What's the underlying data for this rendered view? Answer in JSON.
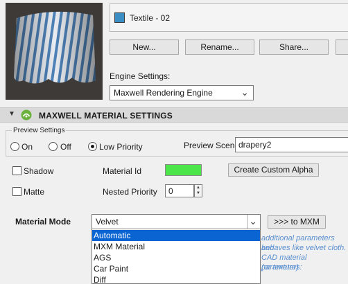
{
  "material": {
    "name": "Textile - 02",
    "swatch_color": "#3b8ec4"
  },
  "toolbar": {
    "new_label": "New...",
    "rename_label": "Rename...",
    "share_label": "Share..."
  },
  "engine": {
    "label": "Engine Settings:",
    "value": "Maxwell Rendering Engine"
  },
  "section": {
    "title": "MAXWELL MATERIAL SETTINGS",
    "logo_color": "#6ab23d"
  },
  "preview": {
    "group_label": "Preview Settings",
    "options": [
      "On",
      "Off",
      "Low Priority"
    ],
    "selected": "Low Priority",
    "scene_label": "Preview Scene",
    "scene_value": "drapery2"
  },
  "props": {
    "shadow_label": "Shadow",
    "matte_label": "Matte",
    "material_id_label": "Material Id",
    "material_id_color": "#4ce64a",
    "custom_alpha_label": "Create Custom Alpha",
    "nested_priority_label": "Nested Priority",
    "nested_priority_value": "0"
  },
  "mode": {
    "label": "Material Mode",
    "value": "Velvet",
    "to_mxm_label": ">>> to MXM",
    "options": [
      "Automatic",
      "MXM Material",
      "AGS",
      "Car Paint",
      "Diff"
    ],
    "highlighted": "Automatic"
  },
  "note": {
    "lines": [
      "additional parameters and",
      "behaves like velvet cloth.",
      "CAD material parameters:",
      "(or texture)"
    ]
  }
}
